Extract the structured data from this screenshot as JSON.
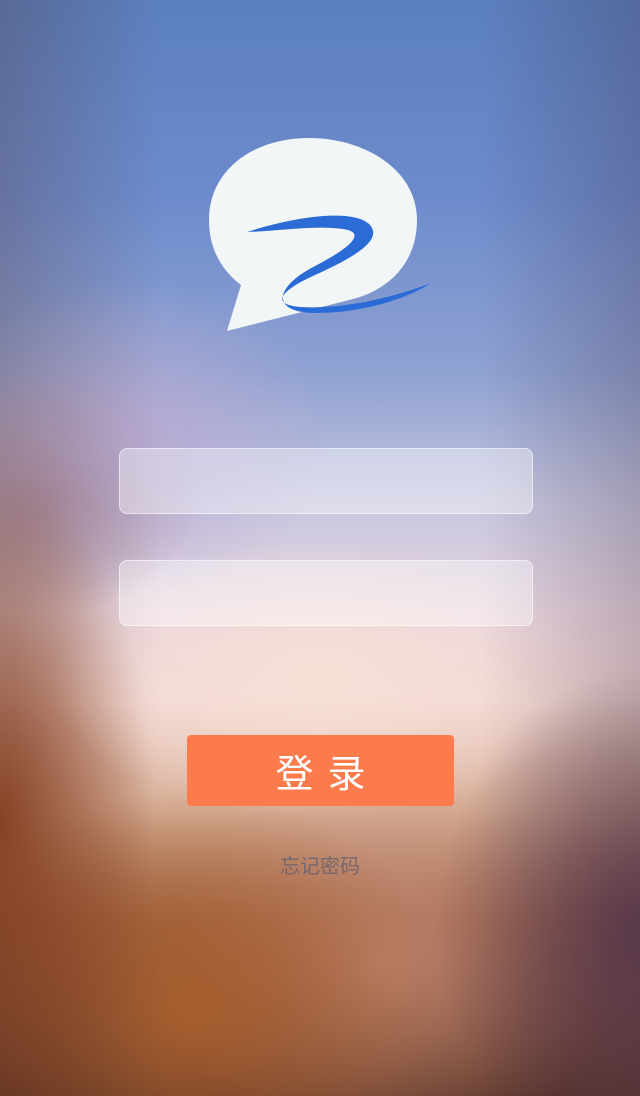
{
  "app": {
    "logo_icon": "chat-bubble-logo-icon"
  },
  "form": {
    "username": {
      "value": "",
      "placeholder": ""
    },
    "password": {
      "value": "",
      "placeholder": ""
    },
    "login_label": "登录",
    "forgot_password_label": "忘记密码"
  },
  "colors": {
    "accent": "#fc7b4d",
    "logo_blue": "#2a6bd6",
    "logo_bubble": "#f2f6f6"
  }
}
